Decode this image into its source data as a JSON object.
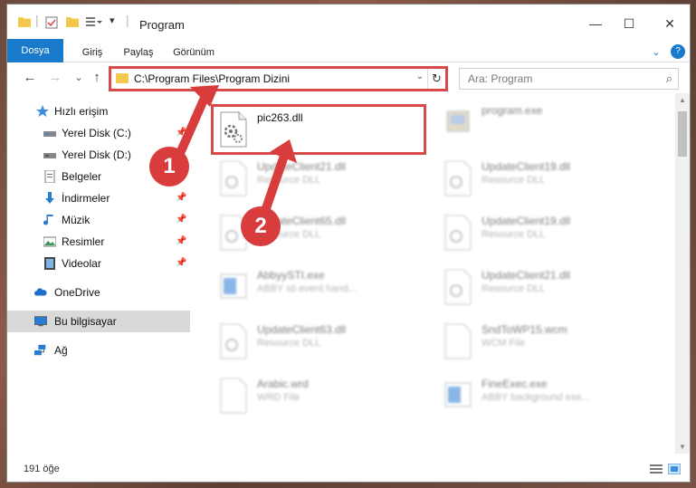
{
  "window": {
    "title": "Program",
    "minimize": "—",
    "maximize": "☐",
    "close": "✕"
  },
  "ribbon": {
    "tabs": [
      "Dosya",
      "Giriş",
      "Paylaş",
      "Görünüm"
    ],
    "expand": "⌄",
    "help": "?"
  },
  "nav": {
    "back": "←",
    "forward": "→",
    "recent": "⌄",
    "up": "↑",
    "address": "C:\\Program Files\\Program Dizini",
    "address_drop": "⌄",
    "refresh": "↻",
    "search_placeholder": "Ara: Program",
    "search_icon": "⌕"
  },
  "sidebar": {
    "items": [
      {
        "label": "Hızlı erişim",
        "icon": "star-icon",
        "pinned": false
      },
      {
        "label": "Yerel Disk (C:)",
        "icon": "drive-icon",
        "pinned": true
      },
      {
        "label": "Yerel Disk (D:)",
        "icon": "drive-icon",
        "pinned": false
      },
      {
        "label": "Belgeler",
        "icon": "documents-icon",
        "pinned": true
      },
      {
        "label": "İndirmeler",
        "icon": "download-icon",
        "pinned": true
      },
      {
        "label": "Müzik",
        "icon": "music-icon",
        "pinned": true
      },
      {
        "label": "Resimler",
        "icon": "pictures-icon",
        "pinned": true
      },
      {
        "label": "Videolar",
        "icon": "video-icon",
        "pinned": true
      },
      {
        "label": "OneDrive",
        "icon": "cloud-icon",
        "pinned": false
      },
      {
        "label": "Bu bilgisayar",
        "icon": "computer-icon",
        "pinned": false,
        "selected": true
      },
      {
        "label": "Ağ",
        "icon": "network-icon",
        "pinned": false
      }
    ],
    "pin_glyph": "📌"
  },
  "files": [
    {
      "name": "pic263.dll",
      "desc": "",
      "icon": "gear-file-icon",
      "highlighted": true
    },
    {
      "name": "program.exe",
      "desc": "",
      "icon": "app-icon"
    },
    {
      "name": "UpdateClient21.dll",
      "desc": "Resource DLL",
      "icon": "dll-icon"
    },
    {
      "name": "UpdateClient19.dll",
      "desc": "Resource DLL",
      "icon": "dll-icon"
    },
    {
      "name": "UpdateClient65.dll",
      "desc": "Resource DLL",
      "icon": "dll-icon"
    },
    {
      "name": "UpdateClient19.dll",
      "desc": "Resource DLL",
      "icon": "dll-icon"
    },
    {
      "name": "AbbyySTI.exe",
      "desc": "ABBY sti event hand...",
      "icon": "exe-icon"
    },
    {
      "name": "UpdateClient21.dll",
      "desc": "Resource DLL",
      "icon": "dll-icon"
    },
    {
      "name": "UpdateClient63.dll",
      "desc": "Resource DLL",
      "icon": "dll-icon"
    },
    {
      "name": "SndToWP15.wcm",
      "desc": "WCM File",
      "icon": "blank-file-icon"
    },
    {
      "name": "Arabic.wrd",
      "desc": "WRD File",
      "icon": "blank-file-icon"
    },
    {
      "name": "FineExec.exe",
      "desc": "ABBY background exe...",
      "icon": "exe-icon"
    }
  ],
  "status": {
    "count": "191 öğe"
  },
  "annotations": {
    "step1": "1",
    "step2": "2"
  },
  "colors": {
    "accent": "#1979ca",
    "highlight": "#d84a4a",
    "folder": "#f2c94c"
  }
}
